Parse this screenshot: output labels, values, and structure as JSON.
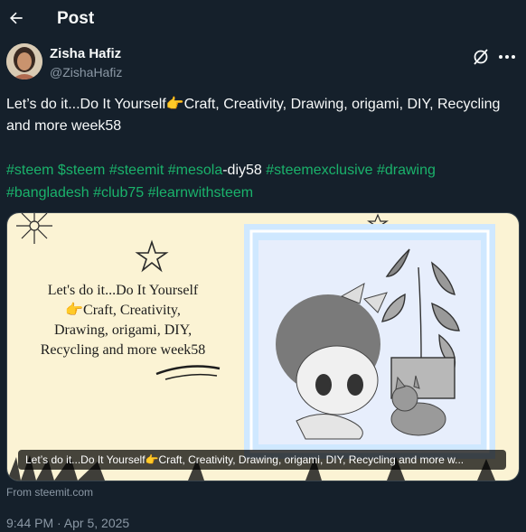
{
  "header": {
    "title": "Post"
  },
  "post": {
    "author_name": "Zisha Hafiz",
    "author_handle": "@ZishaHafiz",
    "text": "Let’s do it...Do It Yourself👉Craft, Creativity, Drawing, origami, DIY, Recycling and more week58",
    "hashtags_line1_a": "#steem $steem #steemit #mesola",
    "hashtags_line1_b": "-diy58",
    "hashtags_line1_c": " #steemexclusive #drawing",
    "hashtags_line2": "#bangladesh #club75 #learnwithsteem",
    "card": {
      "image_text_lines": [
        "Let's do it...Do It Yourself",
        "👉Craft, Creativity,",
        "Drawing, origami, DIY,",
        "Recycling and more week58"
      ],
      "caption": "Let’s do it...Do It Yourself👉Craft, Creativity, Drawing, origami, DIY, Recycling and more w..."
    },
    "source": "From steemit.com",
    "timestamp": "9:44 PM · Apr 5, 2025"
  },
  "icons": {
    "back": "arrow-left-icon",
    "grok": "grok-icon",
    "more": "more-horizontal-icon"
  }
}
